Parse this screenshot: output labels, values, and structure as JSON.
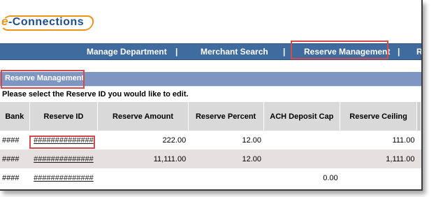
{
  "logo": {
    "e": "e",
    "rest": "-Connections"
  },
  "nav": {
    "items": [
      {
        "label": "Manage Department"
      },
      {
        "label": "Merchant Search"
      },
      {
        "label": "Reserve Management"
      },
      {
        "label": "R"
      }
    ],
    "separator": "|",
    "active": "Reserve Management"
  },
  "section": {
    "title": "Reserve Management"
  },
  "instructions": "Please select the Reserve ID you would like to edit.",
  "table": {
    "headers": [
      "Bank",
      "Reserve ID",
      "Reserve Amount",
      "Reserve Percent",
      "ACH Deposit Cap",
      "Reserve Ceiling"
    ],
    "rows": [
      {
        "bank": "####",
        "reserve_id": "##############",
        "amount": "222.00",
        "percent": "12.00",
        "ach": "",
        "ceiling": "111.00"
      },
      {
        "bank": "####",
        "reserve_id": "##############",
        "amount": "11,111.00",
        "percent": "12.00",
        "ach": "",
        "ceiling": "1,111.00"
      },
      {
        "bank": "####",
        "reserve_id": "##############",
        "amount": "",
        "percent": "",
        "ach": "0.00",
        "ceiling": ""
      }
    ]
  },
  "colors": {
    "nav_bg": "#3f6b9f",
    "section_bg": "#7f95c2",
    "highlight": "#d24a4a",
    "header_bg": "#d9d9d9",
    "alt_row_bg": "#e6e0e0"
  }
}
